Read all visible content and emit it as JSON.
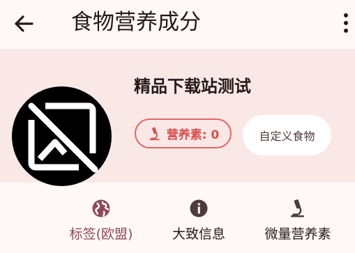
{
  "app_bar": {
    "title": "食物营养成分",
    "back_icon": "arrow-back-icon",
    "more_icon": "more-vert-icon"
  },
  "food": {
    "name": "精品下载站测试",
    "image_icon": "hide-image-icon",
    "nutrients_chip": "营养素: 0",
    "nutrients_icon": "microscope-icon",
    "custom_food_button": "自定义食物"
  },
  "tabs": [
    {
      "label": "标签(欧盟)",
      "icon": "globe-icon",
      "active": true
    },
    {
      "label": "大致信息",
      "icon": "info-icon",
      "active": false
    },
    {
      "label": "微量营养素",
      "icon": "microscope-icon",
      "active": false
    }
  ],
  "colors": {
    "background": "#fff8f7",
    "header_background": "#fae8e7",
    "accent_red": "#d94e4a",
    "active_tab": "#8d4a5e"
  }
}
